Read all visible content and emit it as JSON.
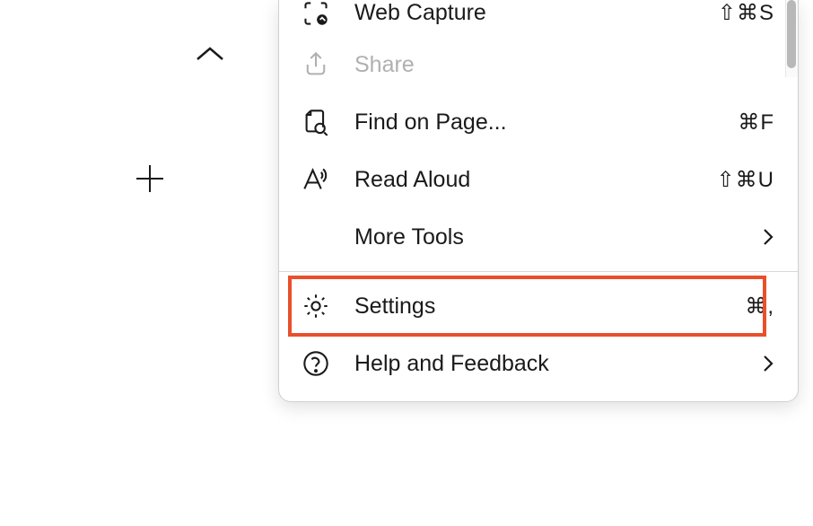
{
  "menu": {
    "items": [
      {
        "id": "web-capture",
        "label": "Web Capture",
        "shortcut": "⇧⌘S",
        "disabled": false,
        "hasSubmenu": false
      },
      {
        "id": "share",
        "label": "Share",
        "shortcut": "",
        "disabled": true,
        "hasSubmenu": false
      },
      {
        "id": "find",
        "label": "Find on Page...",
        "shortcut": "⌘F",
        "disabled": false,
        "hasSubmenu": false
      },
      {
        "id": "read-aloud",
        "label": "Read Aloud",
        "shortcut": "⇧⌘U",
        "disabled": false,
        "hasSubmenu": false
      },
      {
        "id": "more-tools",
        "label": "More Tools",
        "shortcut": "",
        "disabled": false,
        "hasSubmenu": true
      },
      {
        "id": "settings",
        "label": "Settings",
        "shortcut": "⌘,",
        "disabled": false,
        "hasSubmenu": false,
        "highlighted": true
      },
      {
        "id": "help",
        "label": "Help and Feedback",
        "shortcut": "",
        "disabled": false,
        "hasSubmenu": true
      }
    ]
  },
  "colors": {
    "highlight": "#e8502c"
  }
}
